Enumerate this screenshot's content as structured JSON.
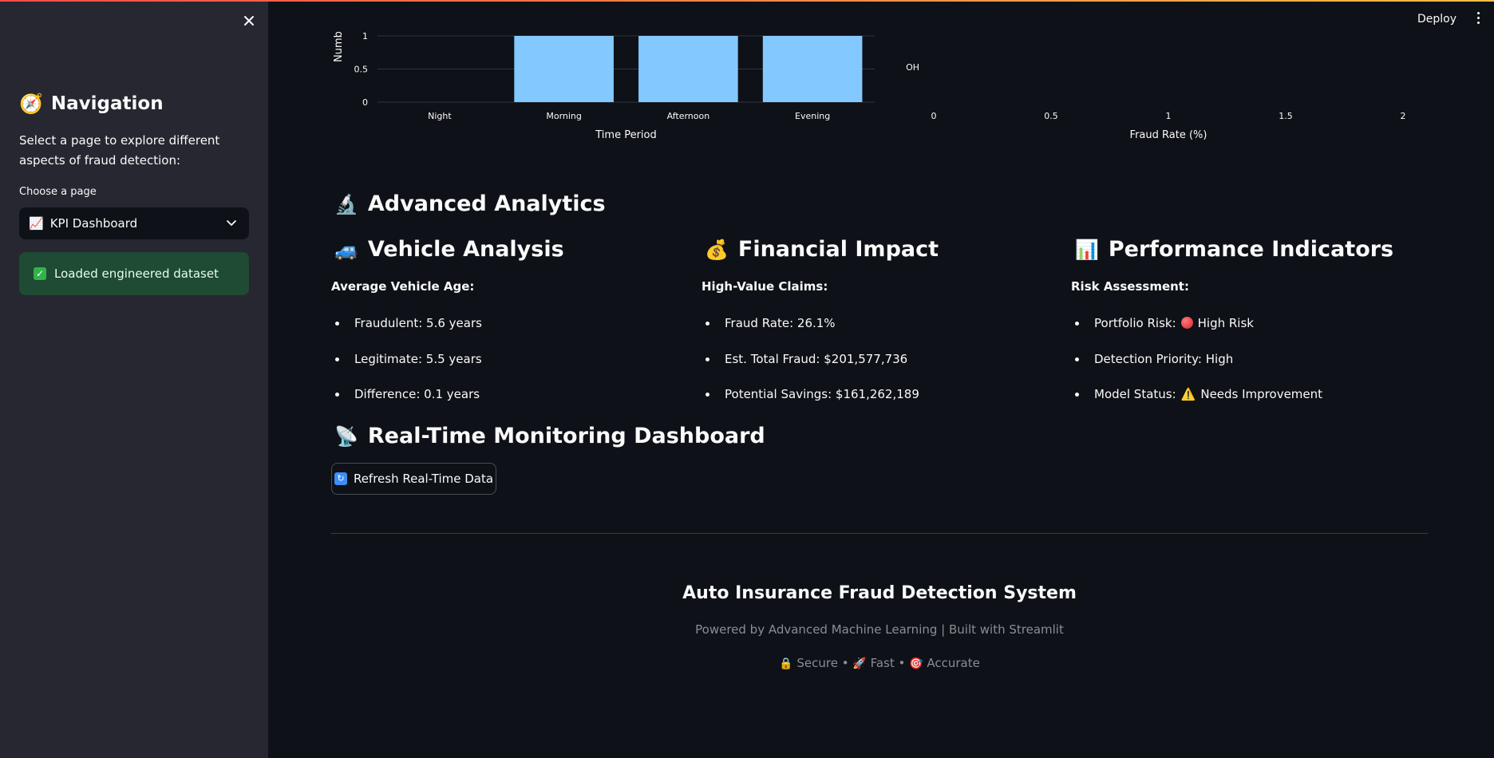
{
  "sidebar": {
    "title": "Navigation",
    "title_icon": "compass-icon",
    "description": "Select a page to explore different aspects of fraud detection:",
    "select_label": "Choose a page",
    "selected_page": "KPI Dashboard",
    "selected_page_icon": "chart-increasing-icon",
    "success_message": "Loaded engineered dataset"
  },
  "header": {
    "deploy_label": "Deploy"
  },
  "chart_data": [
    {
      "type": "bar",
      "categories": [
        "Night",
        "Morning",
        "Afternoon",
        "Evening"
      ],
      "values": [
        0,
        1,
        1,
        1
      ],
      "xlabel": "Time Period",
      "ylabel": "Numb",
      "yticks": [
        "0",
        "0.5",
        "1"
      ],
      "ylim": [
        0,
        1
      ],
      "color": "#83c9ff"
    },
    {
      "type": "bar",
      "orientation": "horizontal",
      "categories": [
        "OH"
      ],
      "values": [
        0
      ],
      "xlabel": "Fraud Rate (%)",
      "xticks": [
        "0",
        "0.5",
        "1",
        "1.5",
        "2"
      ],
      "xlim": [
        0,
        2
      ]
    }
  ],
  "main": {
    "advanced_title": "Advanced Analytics",
    "vehicle": {
      "title": "Vehicle Analysis",
      "subtitle": "Average Vehicle Age:",
      "items": [
        "Fraudulent: 5.6 years",
        "Legitimate: 5.5 years",
        "Difference: 0.1 years"
      ]
    },
    "financial": {
      "title": "Financial Impact",
      "subtitle": "High-Value Claims:",
      "items": [
        "Fraud Rate: 26.1%",
        "Est. Total Fraud: $201,577,736",
        "Potential Savings: $161,262,189"
      ]
    },
    "performance": {
      "title": "Performance Indicators",
      "subtitle": "Risk Assessment:",
      "portfolio_label": "Portfolio Risk:",
      "portfolio_value": "High Risk",
      "priority": "Detection Priority: High",
      "model_label": "Model Status:",
      "model_value": "Needs Improvement"
    },
    "realtime_title": "Real-Time Monitoring Dashboard",
    "refresh_label": "Refresh Real-Time Data"
  },
  "footer": {
    "title": "Auto Insurance Fraud Detection System",
    "subtitle": "Powered by Advanced Machine Learning | Built with Streamlit",
    "secure": "Secure",
    "fast": "Fast",
    "accurate": "Accurate",
    "separator": "•"
  }
}
